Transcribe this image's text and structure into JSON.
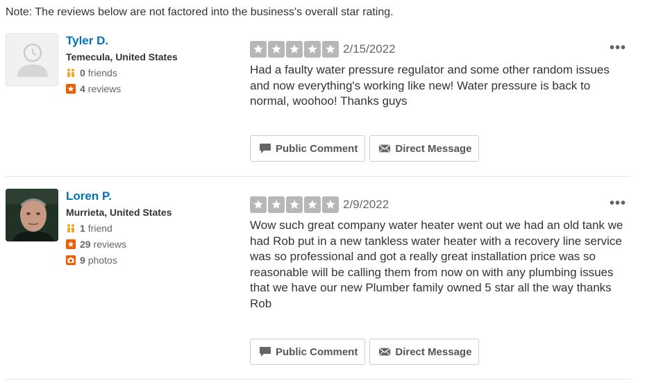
{
  "note": "Note: The reviews below are not factored into the business's overall star rating.",
  "reviews": [
    {
      "user": {
        "name": "Tyler D.",
        "location": "Temecula, United States",
        "friends_count": "0",
        "friends_label": "friends",
        "reviews_count": "4",
        "reviews_label": "reviews"
      },
      "rating": 5,
      "date": "2/15/2022",
      "text": "Had a faulty water pressure regulator and some other random issues and now everything's working like new!  Water pressure is back to normal, woohoo!  Thanks guys",
      "actions": {
        "public_comment": "Public Comment",
        "direct_message": "Direct Message"
      }
    },
    {
      "user": {
        "name": "Loren P.",
        "location": "Murrieta, United States",
        "friends_count": "1",
        "friends_label": "friend",
        "reviews_count": "29",
        "reviews_label": "reviews",
        "photos_count": "9",
        "photos_label": "photos"
      },
      "rating": 5,
      "date": "2/9/2022",
      "text": "Wow such great company water heater went out we had an old tank we had Rob put in a new tankless water heater with a recovery line service was so professional and got a really great installation price was so reasonable will be calling them from now on with any plumbing issues that we have our new Plumber family owned 5 star all the way thanks Rob",
      "actions": {
        "public_comment": "Public Comment",
        "direct_message": "Direct Message"
      }
    }
  ],
  "colors": {
    "user_link": "#0073bb",
    "star_gray": "#b7b7b7",
    "stat_icon_orange": "#f15c00",
    "friends_icon_orange": "#f5a623"
  },
  "icons": {
    "friends": "friends-icon",
    "reviews": "star-badge-icon",
    "photos": "camera-icon",
    "more": "more-options-icon",
    "comment": "speech-bubble-icon",
    "message": "envelope-icon"
  }
}
